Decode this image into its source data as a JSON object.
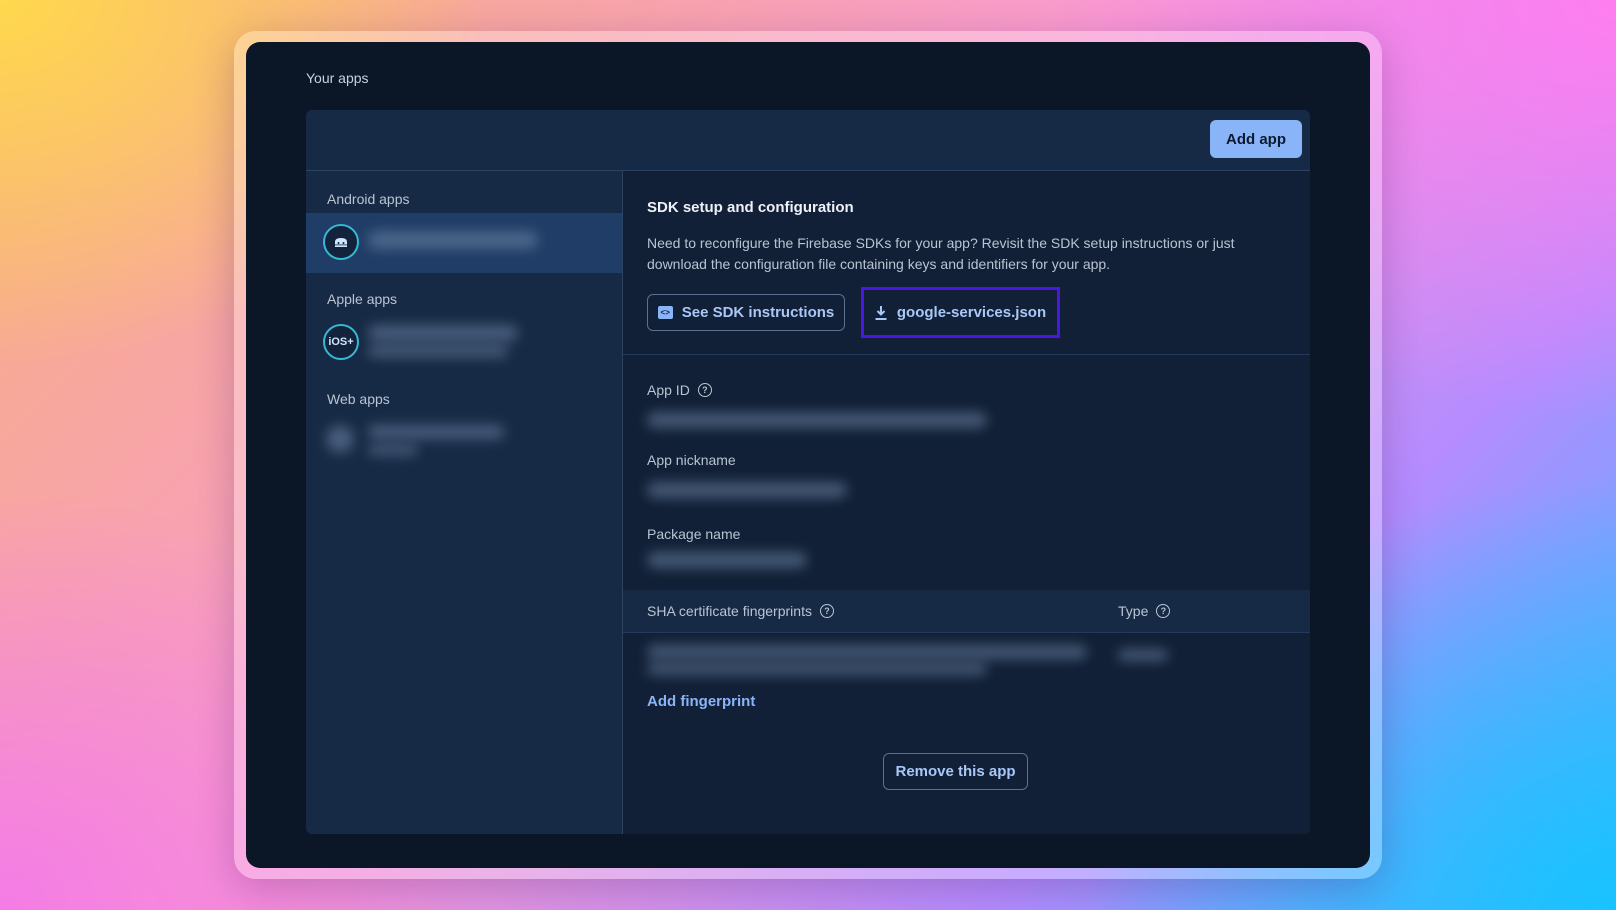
{
  "page": {
    "section_title": "Your apps"
  },
  "header": {
    "add_app_label": "Add app"
  },
  "sidebar": {
    "groups": [
      {
        "label": "Android apps",
        "icon": "android-icon"
      },
      {
        "label": "Apple apps",
        "icon": "ios-icon",
        "icon_text": "iOS+"
      },
      {
        "label": "Web apps",
        "icon": "web-icon"
      }
    ]
  },
  "sdk": {
    "title": "SDK setup and configuration",
    "description": "Need to reconfigure the Firebase SDKs for your app? Revisit the SDK setup instructions or just download the configuration file containing keys and identifiers for your app.",
    "instructions_label": "See SDK instructions",
    "config_file_label": "google-services.json"
  },
  "fields": {
    "app_id_label": "App ID",
    "app_nickname_label": "App nickname",
    "package_name_label": "Package name"
  },
  "sha": {
    "column_fingerprints": "SHA certificate fingerprints",
    "column_type": "Type",
    "add_fingerprint_label": "Add fingerprint"
  },
  "remove_app_label": "Remove this app",
  "colors": {
    "accent": "#8ab4f8",
    "highlight_border": "#4a16e6",
    "panel": "#172a45",
    "background": "#0b1727"
  }
}
